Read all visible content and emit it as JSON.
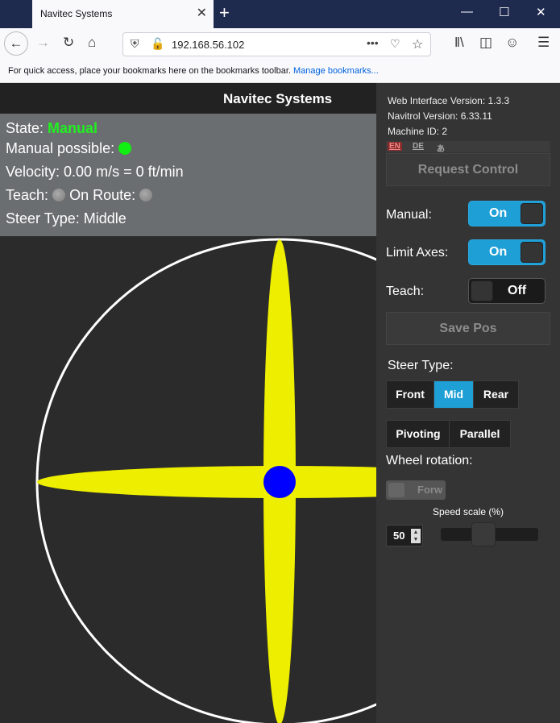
{
  "browser": {
    "tab_title": "Navitec Systems",
    "tab_close": "✕",
    "new_tab": "+",
    "url": "192.168.56.102",
    "bookmarks_text": "For quick access, place your bookmarks here on the bookmarks toolbar.",
    "bookmarks_link": "Manage bookmarks..."
  },
  "app": {
    "title": "Navitec Systems"
  },
  "status": {
    "state_label": "State:",
    "state_value": "Manual",
    "manual_possible_label": "Manual possible:",
    "velocity": "Velocity: 0.00 m/s = 0 ft/min",
    "teach_label": "Teach:",
    "on_route_label": "On Route:",
    "steer_type": "Steer Type: Middle"
  },
  "panel": {
    "web_version": "Web Interface Version: 1.3.3",
    "navitrol_version": "Navitrol Version: 6.33.11",
    "machine_id": "Machine ID: 2",
    "languages": [
      "EN",
      "DE",
      "あ"
    ],
    "request_control": "Request Control",
    "manual_label": "Manual:",
    "manual_toggle": "On",
    "limit_axes_label": "Limit Axes:",
    "limit_axes_toggle": "On",
    "teach_label": "Teach:",
    "teach_toggle": "Off",
    "save_pos": "Save Pos",
    "steer_type_label": "Steer Type:",
    "steer_options": [
      "Front",
      "Mid",
      "Rear"
    ],
    "steer_selected": "Mid",
    "mode_options": [
      "Pivoting",
      "Parallel"
    ],
    "wheel_rotation_label": "Wheel rotation:",
    "wheel_rotation_value": "Forw",
    "speed_scale_label": "Speed scale (%)",
    "speed_scale_value": "50",
    "speed_scale_slider": 0.5
  },
  "colors": {
    "accent": "#1e9fd6",
    "state_green": "#22ee22",
    "arm_yellow": "#eeee00",
    "center_blue": "#0000ff"
  }
}
